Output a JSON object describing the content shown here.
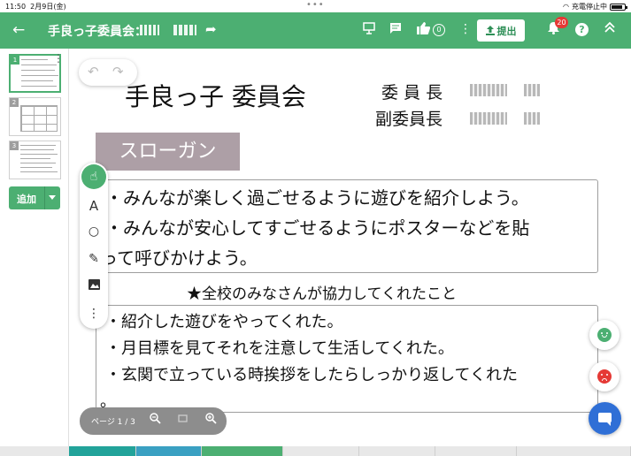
{
  "status_bar": {
    "time": "11:50",
    "date": "2月9日(金)",
    "charging_text": "充電停止中",
    "battery_level": 0.85
  },
  "toolbar": {
    "back_icon": "arrow-left-icon",
    "title": "手良っ子委員会：",
    "share_icon": "share-icon",
    "like_count": "0",
    "submit_label": "提出",
    "notification_count": "20",
    "help_label": "?",
    "accent_color": "#4caf72"
  },
  "rail": {
    "pages": [
      {
        "number": "1",
        "active": true
      },
      {
        "number": "2",
        "active": false
      },
      {
        "number": "3",
        "active": false
      }
    ],
    "add_label": "追加"
  },
  "canvas": {
    "title": "手良っ子 委員会",
    "role_chair": "委 員 長",
    "role_vice": "副委員長",
    "slogan_label": "スローガン",
    "slogan_lines": [
      "・みんなが楽しく過ごせるように遊びを紹介しよう。",
      "・みんなが安心してすごせるようにポスターなどを貼",
      "って呼びかけよう。"
    ],
    "cooperation_heading": "★全校のみなさんが協力してくれたこと",
    "cooperation_lines": [
      "・紹介した遊びをやってくれた。",
      "・月目標を見てそれを注意して生活してくれた。",
      "・玄関で立っている時挨拶をしたらしっかり返してくれた",
      "。"
    ]
  },
  "pager": {
    "label": "ページ 1 / 3"
  },
  "reactions": {
    "positive_color": "#4caf72",
    "negative_color": "#e53935",
    "chat_color": "#2f6fd6"
  }
}
